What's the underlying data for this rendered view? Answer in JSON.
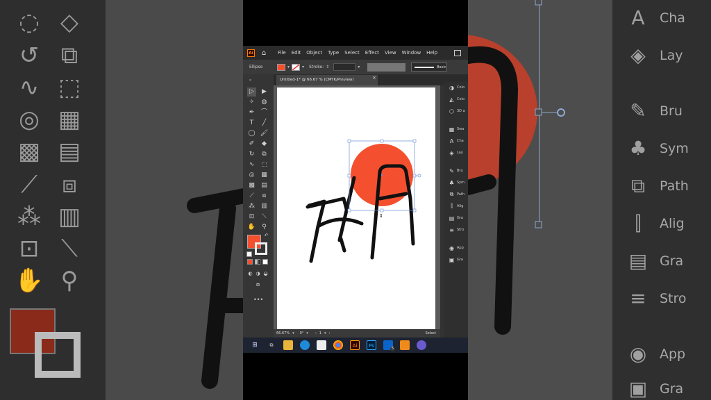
{
  "app": {
    "logo": "Ai",
    "menus": [
      "File",
      "Edit",
      "Object",
      "Type",
      "Select",
      "Effect",
      "View",
      "Window",
      "Help"
    ]
  },
  "control_bar": {
    "selection_label": "Ellipse",
    "stroke_label": "Stroke:",
    "style_label": "Basic",
    "fill_color": "#f4502f"
  },
  "document": {
    "tab_title": "Untitled-1* @ 66.67 % (CMYK/Preview)",
    "close": "×"
  },
  "status": {
    "zoom": "66.67%",
    "rotation": "0°",
    "page": "1",
    "tool": "Select"
  },
  "right_panel": {
    "items": [
      "Colo",
      "Colo",
      "3D a",
      "Swa",
      "Cha",
      "Lay",
      "Bru",
      "Sym",
      "Path",
      "Alig",
      "Gra",
      "Stro",
      "App",
      "Gra"
    ]
  },
  "background_right": {
    "items": [
      "Cha",
      "Lay",
      "Bru",
      "Sym",
      "Path",
      "Alig",
      "Gra",
      "Stro",
      "App",
      "Gra"
    ]
  },
  "taskbar": {
    "ps_label": "Ps",
    "ai_label": "Ai",
    "mail_badge": "5"
  },
  "colors": {
    "accent": "#f4502f",
    "ui_dark": "#323232",
    "ui_panel": "#2f2f2f"
  }
}
